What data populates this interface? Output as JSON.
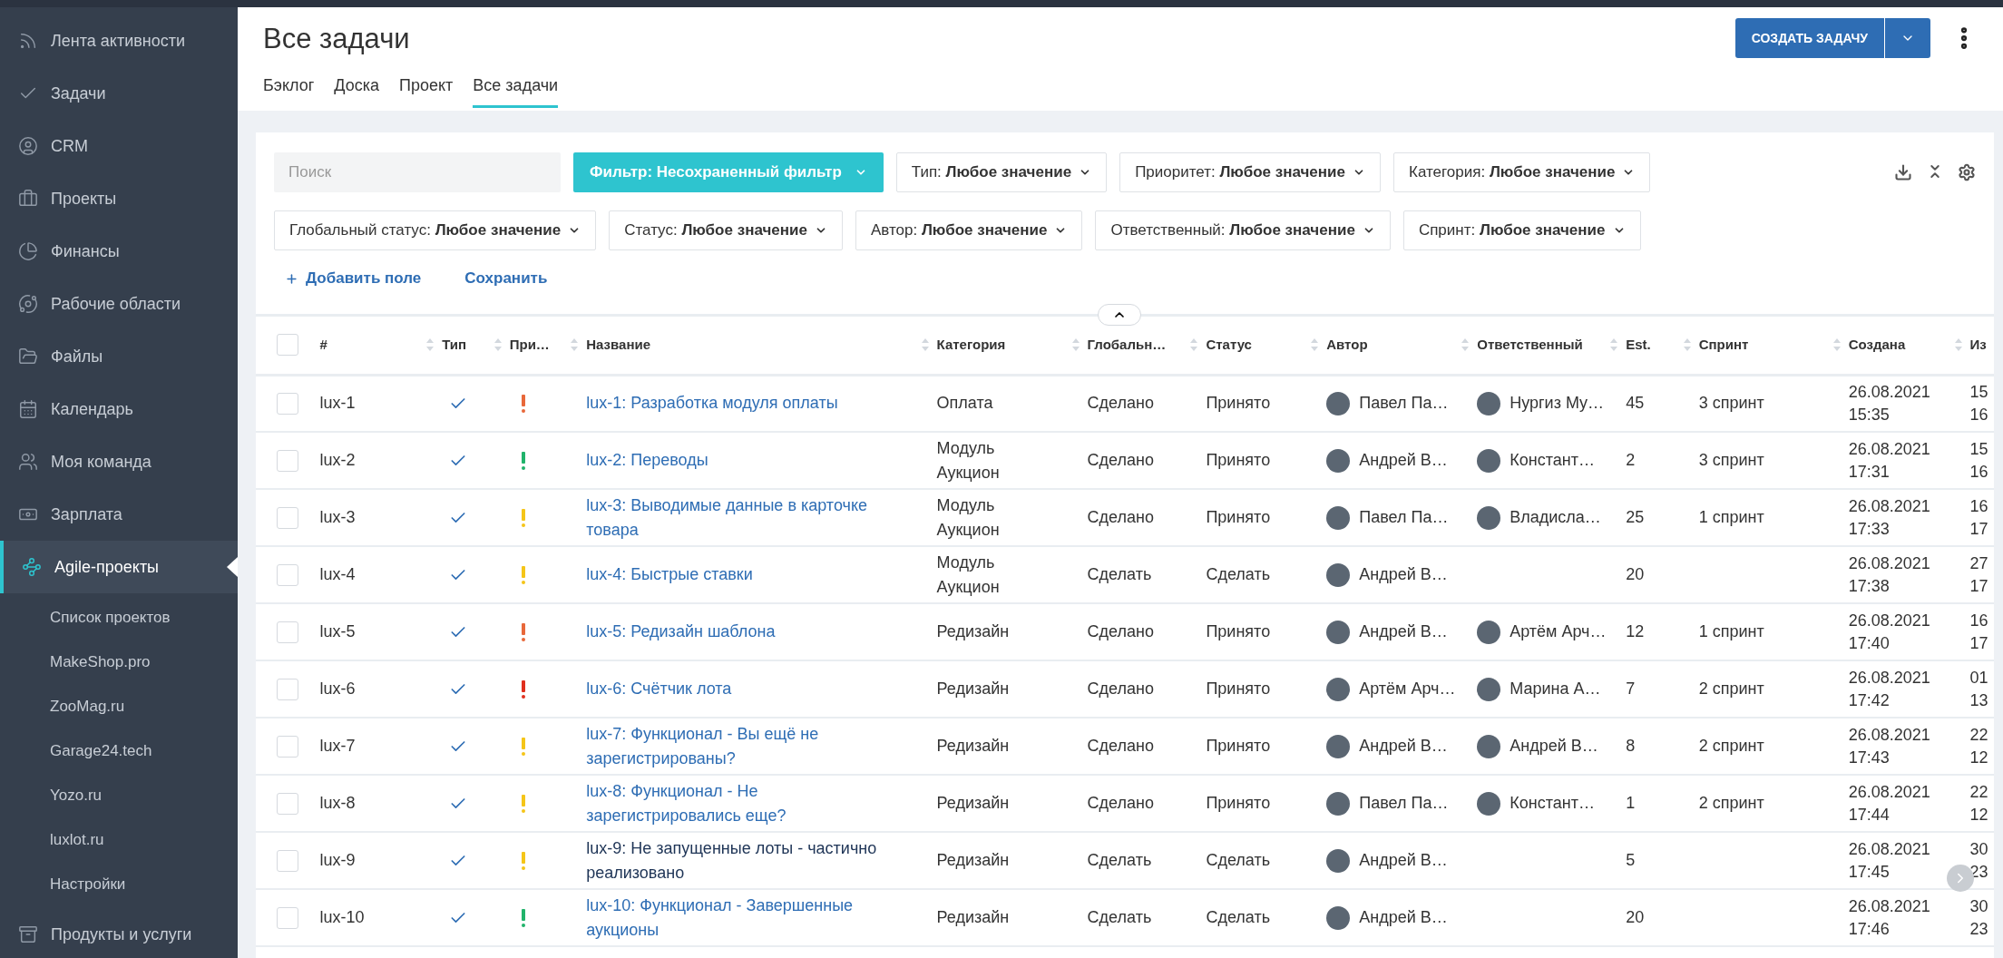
{
  "sidebar": {
    "items": [
      {
        "label": "Лента активности",
        "selected": false
      },
      {
        "label": "Задачи",
        "selected": false
      },
      {
        "label": "CRM",
        "selected": false
      },
      {
        "label": "Проекты",
        "selected": false
      },
      {
        "label": "Финансы",
        "selected": false
      },
      {
        "label": "Рабочие области",
        "selected": false
      },
      {
        "label": "Файлы",
        "selected": false
      },
      {
        "label": "Календарь",
        "selected": false
      },
      {
        "label": "Моя команда",
        "selected": false
      },
      {
        "label": "Зарплата",
        "selected": false
      },
      {
        "label": "Agile-проекты",
        "selected": true,
        "expanded": true,
        "children": [
          {
            "label": "Список проектов"
          },
          {
            "label": "MakeShop.pro"
          },
          {
            "label": "ZooMag.ru"
          },
          {
            "label": "Garage24.tech"
          },
          {
            "label": "Yozo.ru"
          },
          {
            "label": "luxlot.ru"
          },
          {
            "label": "Настройки"
          }
        ]
      },
      {
        "label": "Продукты и услуги",
        "selected": false
      }
    ]
  },
  "header": {
    "title": "Все задачи",
    "tabs": [
      {
        "label": "Бэклог",
        "selected": false
      },
      {
        "label": "Доска",
        "selected": false
      },
      {
        "label": "Проект",
        "selected": false
      },
      {
        "label": "Все задачи",
        "selected": true
      }
    ],
    "create_button": "СОЗДАТЬ ЗАДАЧУ"
  },
  "filters": {
    "search": {
      "placeholder": "Поиск"
    },
    "filter_button": "Фильтр: Несохраненный фильтр",
    "chips": [
      {
        "label": "Тип:",
        "value": "Любое значение"
      },
      {
        "label": "Приоритет:",
        "value": "Любое значение"
      },
      {
        "label": "Категория:",
        "value": "Любое значение"
      },
      {
        "label": "Глобальный статус:",
        "value": "Любое значение"
      },
      {
        "label": "Статус:",
        "value": "Любое значение"
      },
      {
        "label": "Автор:",
        "value": "Любое значение"
      },
      {
        "label": "Ответственный:",
        "value": "Любое значение"
      },
      {
        "label": "Спринт:",
        "value": "Любое значение"
      }
    ],
    "add_field": "Добавить поле",
    "save": "Сохранить"
  },
  "table": {
    "all_checked": false,
    "columns": [
      "#",
      "Тип",
      "При…",
      "Название",
      "Категория",
      "Глобальн…",
      "Статус",
      "Автор",
      "Ответственный",
      "Est.",
      "Спринт",
      "Создана",
      "Из"
    ],
    "rows": [
      {
        "id": "lux-1",
        "checked": false,
        "color": "#e8683a",
        "title": "lux-1: Разработка модуля оплаты",
        "visited": false,
        "category": "Оплата",
        "global_status": "Сделано",
        "status": "Принято",
        "author": "Павел Па…",
        "assignee": "Нургиз Му…",
        "est": "45",
        "sprint": "3 спринт",
        "created": [
          "26.08.2021",
          "15:35"
        ],
        "column_14": [
          "15",
          "16"
        ]
      },
      {
        "id": "lux-2",
        "checked": false,
        "color": "#21b36b",
        "title": "lux-2: Переводы",
        "visited": false,
        "category": "Модуль Аукцион",
        "global_status": "Сделано",
        "status": "Принято",
        "author": "Андрей В…",
        "assignee": "Констант…",
        "est": "2",
        "sprint": "3 спринт",
        "created": [
          "26.08.2021",
          "17:31"
        ],
        "column_14": [
          "15",
          "16"
        ]
      },
      {
        "id": "lux-3",
        "checked": false,
        "color": "#f5c518",
        "title": "lux-3: Выводимые данные в карточке товара",
        "visited": false,
        "category": "Модуль Аукцион",
        "global_status": "Сделано",
        "status": "Принято",
        "author": "Павел Па…",
        "assignee": "Владисла…",
        "est": "25",
        "sprint": "1 спринт",
        "created": [
          "26.08.2021",
          "17:33"
        ],
        "column_14": [
          "16",
          "17"
        ]
      },
      {
        "id": "lux-4",
        "checked": false,
        "color": "#f5c518",
        "title": "lux-4: Быстрые ставки",
        "visited": false,
        "category": "Модуль Аукцион",
        "global_status": "Сделать",
        "status": "Сделать",
        "author": "Андрей В…",
        "est": "20",
        "created": [
          "26.08.2021",
          "17:38"
        ],
        "column_14": [
          "27",
          "17"
        ]
      },
      {
        "id": "lux-5",
        "checked": false,
        "color": "#e8683a",
        "title": "lux-5: Редизайн шаблона",
        "visited": false,
        "category": "Редизайн",
        "global_status": "Сделано",
        "status": "Принято",
        "author": "Андрей В…",
        "assignee": "Артём Арч…",
        "est": "12",
        "sprint": "1 спринт",
        "created": [
          "26.08.2021",
          "17:40"
        ],
        "column_14": [
          "16",
          "17"
        ]
      },
      {
        "id": "lux-6",
        "checked": false,
        "color": "#e0301e",
        "title": "lux-6: Счётчик лота",
        "visited": false,
        "category": "Редизайн",
        "global_status": "Сделано",
        "status": "Принято",
        "author": "Артём Арч…",
        "assignee": "Марина А…",
        "est": "7",
        "sprint": "2 спринт",
        "created": [
          "26.08.2021",
          "17:42"
        ],
        "column_14": [
          "01",
          "13"
        ]
      },
      {
        "id": "lux-7",
        "checked": false,
        "color": "#f5c518",
        "title": "lux-7: Функционал - Вы ещё не зарегистрированы?",
        "visited": false,
        "category": "Редизайн",
        "global_status": "Сделано",
        "status": "Принято",
        "author": "Андрей В…",
        "assignee": "Андрей В…",
        "est": "8",
        "sprint": "2 спринт",
        "created": [
          "26.08.2021",
          "17:43"
        ],
        "column_14": [
          "22",
          "12"
        ]
      },
      {
        "id": "lux-8",
        "checked": false,
        "color": "#f5c518",
        "title": "lux-8: Функционал - Не зарегистрировались еще?",
        "visited": false,
        "category": "Редизайн",
        "global_status": "Сделано",
        "status": "Принято",
        "author": "Павел Па…",
        "assignee": "Констант…",
        "est": "1",
        "sprint": "2 спринт",
        "created": [
          "26.08.2021",
          "17:44"
        ],
        "column_14": [
          "22",
          "12"
        ]
      },
      {
        "id": "lux-9",
        "checked": false,
        "color": "#f5c518",
        "title": "lux-9: Не запущенные лоты - частично реализовано",
        "visited": true,
        "category": "Редизайн",
        "global_status": "Сделать",
        "status": "Сделать",
        "author": "Андрей В…",
        "est": "5",
        "created": [
          "26.08.2021",
          "17:45"
        ],
        "column_14": [
          "30",
          "23"
        ]
      },
      {
        "id": "lux-10",
        "checked": false,
        "color": "#21b36b",
        "title": "lux-10: Функционал - Завершенные аукционы",
        "visited": false,
        "category": "Редизайн",
        "global_status": "Сделать",
        "status": "Сделать",
        "author": "Андрей В…",
        "est": "20",
        "created": [
          "26.08.2021",
          "17:46"
        ],
        "column_14": [
          "30",
          "23"
        ]
      }
    ]
  }
}
